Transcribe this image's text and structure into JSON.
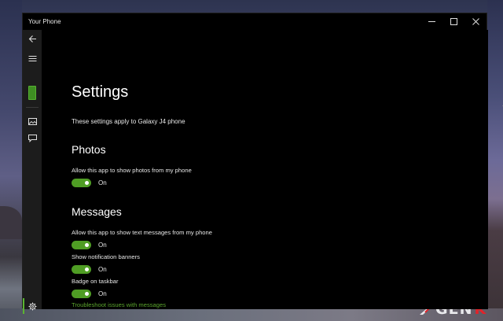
{
  "window": {
    "title": "Your Phone",
    "caption_buttons": [
      {
        "name": "minimize",
        "icon": "minimize-icon"
      },
      {
        "name": "maximize",
        "icon": "maximize-icon"
      },
      {
        "name": "close",
        "icon": "close-icon"
      }
    ]
  },
  "sidebar": {
    "items": [
      {
        "name": "back",
        "icon": "back-arrow-icon"
      },
      {
        "name": "menu",
        "icon": "hamburger-icon"
      },
      {
        "name": "phone",
        "icon": "phone-icon"
      },
      {
        "name": "photos",
        "icon": "photos-icon"
      },
      {
        "name": "messages",
        "icon": "message-icon"
      },
      {
        "name": "settings",
        "icon": "gear-icon",
        "active": true
      }
    ],
    "accent_color": "#5bb531"
  },
  "settings": {
    "title": "Settings",
    "subtitle": "These settings apply to Galaxy J4 phone",
    "photos": {
      "heading": "Photos",
      "show_photos": {
        "label": "Allow this app to show photos from my phone",
        "state": "On",
        "enabled": true
      }
    },
    "messages": {
      "heading": "Messages",
      "show_messages": {
        "label": "Allow this app to show text messages from my phone",
        "state": "On",
        "enabled": true
      },
      "notification_banners": {
        "label": "Show notification banners",
        "state": "On",
        "enabled": true
      },
      "badge_taskbar": {
        "label": "Badge on taskbar",
        "state": "On",
        "enabled": true
      },
      "troubleshoot_link": "Troubleshoot issues with messages"
    }
  },
  "watermark": {
    "text_main": "GEN",
    "text_accent": "K",
    "accent_color": "#e2232a"
  },
  "colors": {
    "toggle_on": "#4f9d24",
    "link": "#5aa52c",
    "window_bg": "#000000",
    "sidebar_bg": "#1c1c1c"
  }
}
